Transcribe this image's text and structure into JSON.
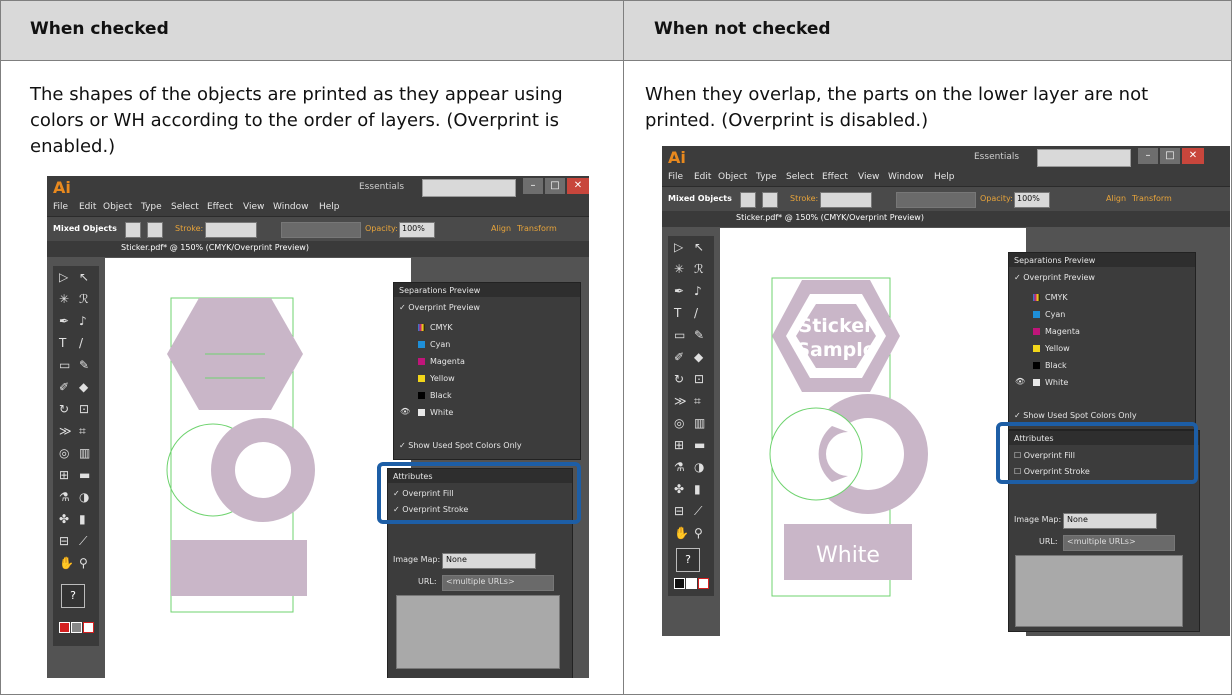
{
  "headers": {
    "left": "When checked",
    "right": "When not checked"
  },
  "descriptions": {
    "left": "The shapes of the objects are printed as they appear using colors or WH according to the order of layers. (Overprint is enabled.)",
    "right": "When they overlap, the parts on the lower layer are not printed. (Overprint is disabled.)"
  },
  "app": {
    "logo": "Ai",
    "workspace": "Essentials",
    "menu": [
      "File",
      "Edit",
      "Object",
      "Type",
      "Select",
      "Effect",
      "View",
      "Window",
      "Help"
    ],
    "control_bar": {
      "selection": "Mixed Objects",
      "stroke": "Stroke:",
      "opacity_label": "Opacity:",
      "opacity_value": "100%",
      "align": "Align",
      "transform": "Transform"
    },
    "document_tab": "Sticker.pdf* @ 150% (CMYK/Overprint Preview)",
    "separations": {
      "title": "Separations Preview",
      "overprint_preview": "Overprint Preview",
      "plates": [
        "CMYK",
        "Cyan",
        "Magenta",
        "Yellow",
        "Black"
      ],
      "white": "White",
      "show_used": "Show Used Spot Colors Only"
    },
    "attributes": {
      "title": "Attributes",
      "overprint_fill": "Overprint Fill",
      "overprint_stroke": "Overprint Stroke",
      "image_map_label": "Image Map:",
      "image_map_value": "None",
      "url_label": "URL:",
      "url_value": "<multiple URLs>"
    },
    "artwork_text": {
      "line1": "Sticker",
      "line2": "Sample",
      "white": "White"
    }
  },
  "colors": {
    "header_bg": "#d9d9d9",
    "ui_bg": "#535353",
    "artwork": "#c9b6c8",
    "selection": "#6fd36f",
    "highlight": "#1d5ea6",
    "cmyk_cyan": "#1e8fd8",
    "cmyk_magenta": "#c0157a",
    "cmyk_yellow": "#f2d61a",
    "cmyk_black": "#000000"
  }
}
